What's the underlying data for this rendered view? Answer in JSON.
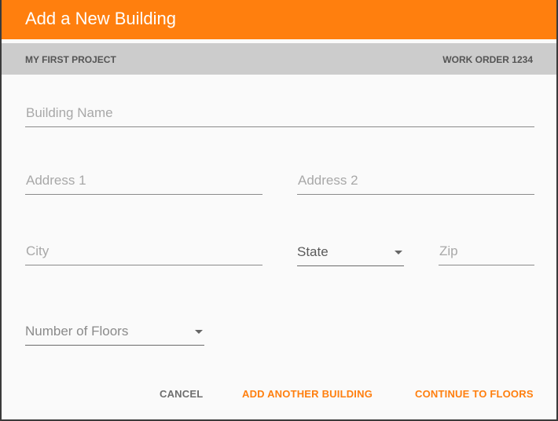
{
  "dialog": {
    "title": "Add a New Building",
    "project": "MY FIRST PROJECT",
    "work_order": "WORK ORDER 1234"
  },
  "form": {
    "building_name_placeholder": "Building Name",
    "address1_placeholder": "Address 1",
    "address2_placeholder": "Address 2",
    "city_placeholder": "City",
    "state_label": "State",
    "zip_placeholder": "Zip",
    "floors_label": "Number of Floors"
  },
  "actions": {
    "cancel": "CANCEL",
    "add_another": "ADD ANOTHER BUILDING",
    "continue": "CONTINUE TO FLOORS"
  },
  "colors": {
    "accent": "#ff7f0e",
    "subheader_bg": "#cccccc",
    "muted_text": "#a8a8a8"
  },
  "icons": {
    "select_caret": "caret-down-icon"
  }
}
